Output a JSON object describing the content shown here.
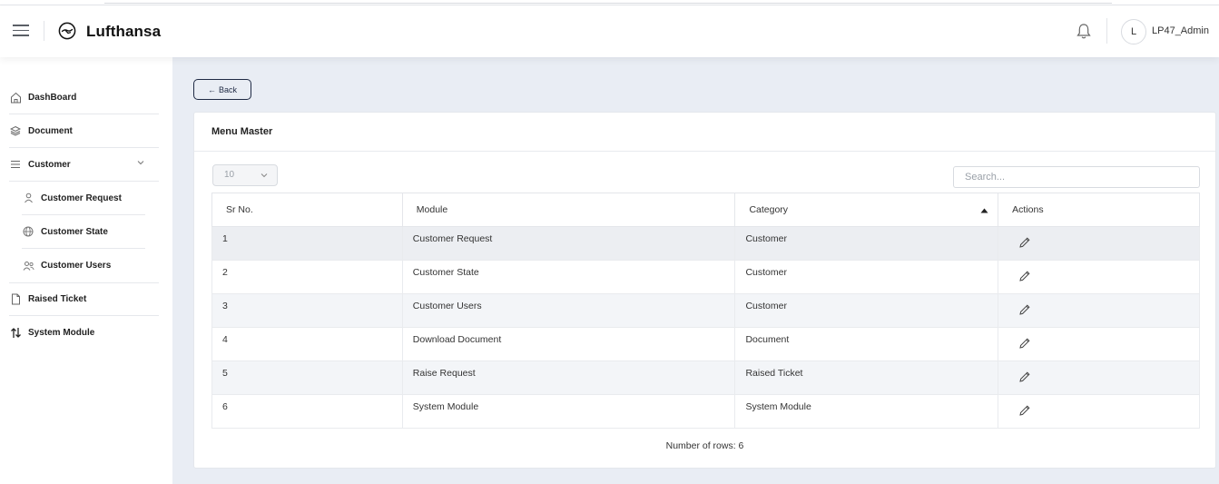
{
  "header": {
    "brand": "Lufthansa",
    "avatar_initial": "L",
    "username": "LP47_Admin"
  },
  "sidebar": {
    "items": [
      {
        "label": "DashBoard",
        "icon": "home-icon"
      },
      {
        "label": "Document",
        "icon": "layers-icon"
      },
      {
        "label": "Customer",
        "icon": "list-icon"
      },
      {
        "label": "Customer Request",
        "icon": "user-icon"
      },
      {
        "label": "Customer State",
        "icon": "globe-icon"
      },
      {
        "label": "Customer Users",
        "icon": "users-icon"
      },
      {
        "label": "Raised Ticket",
        "icon": "file-icon"
      },
      {
        "label": "System Module",
        "icon": "swap-icon"
      }
    ]
  },
  "main": {
    "back_label": "Back",
    "card_title": "Menu Master",
    "page_size": "10",
    "search_placeholder": "Search...",
    "columns": [
      "Sr No.",
      "Module",
      "Category",
      "Actions"
    ],
    "rows": [
      {
        "sr": "1",
        "module": "Customer Request",
        "category": "Customer"
      },
      {
        "sr": "2",
        "module": "Customer State",
        "category": "Customer"
      },
      {
        "sr": "3",
        "module": "Customer Users",
        "category": "Customer"
      },
      {
        "sr": "4",
        "module": "Download Document",
        "category": "Document"
      },
      {
        "sr": "5",
        "module": "Raise Request",
        "category": "Raised Ticket"
      },
      {
        "sr": "6",
        "module": "System Module",
        "category": "System Module"
      }
    ],
    "row_count_text": "Number of rows: 6"
  },
  "colors": {
    "brand_dark": "#1f2a44",
    "page_bg": "#e9edf4"
  }
}
